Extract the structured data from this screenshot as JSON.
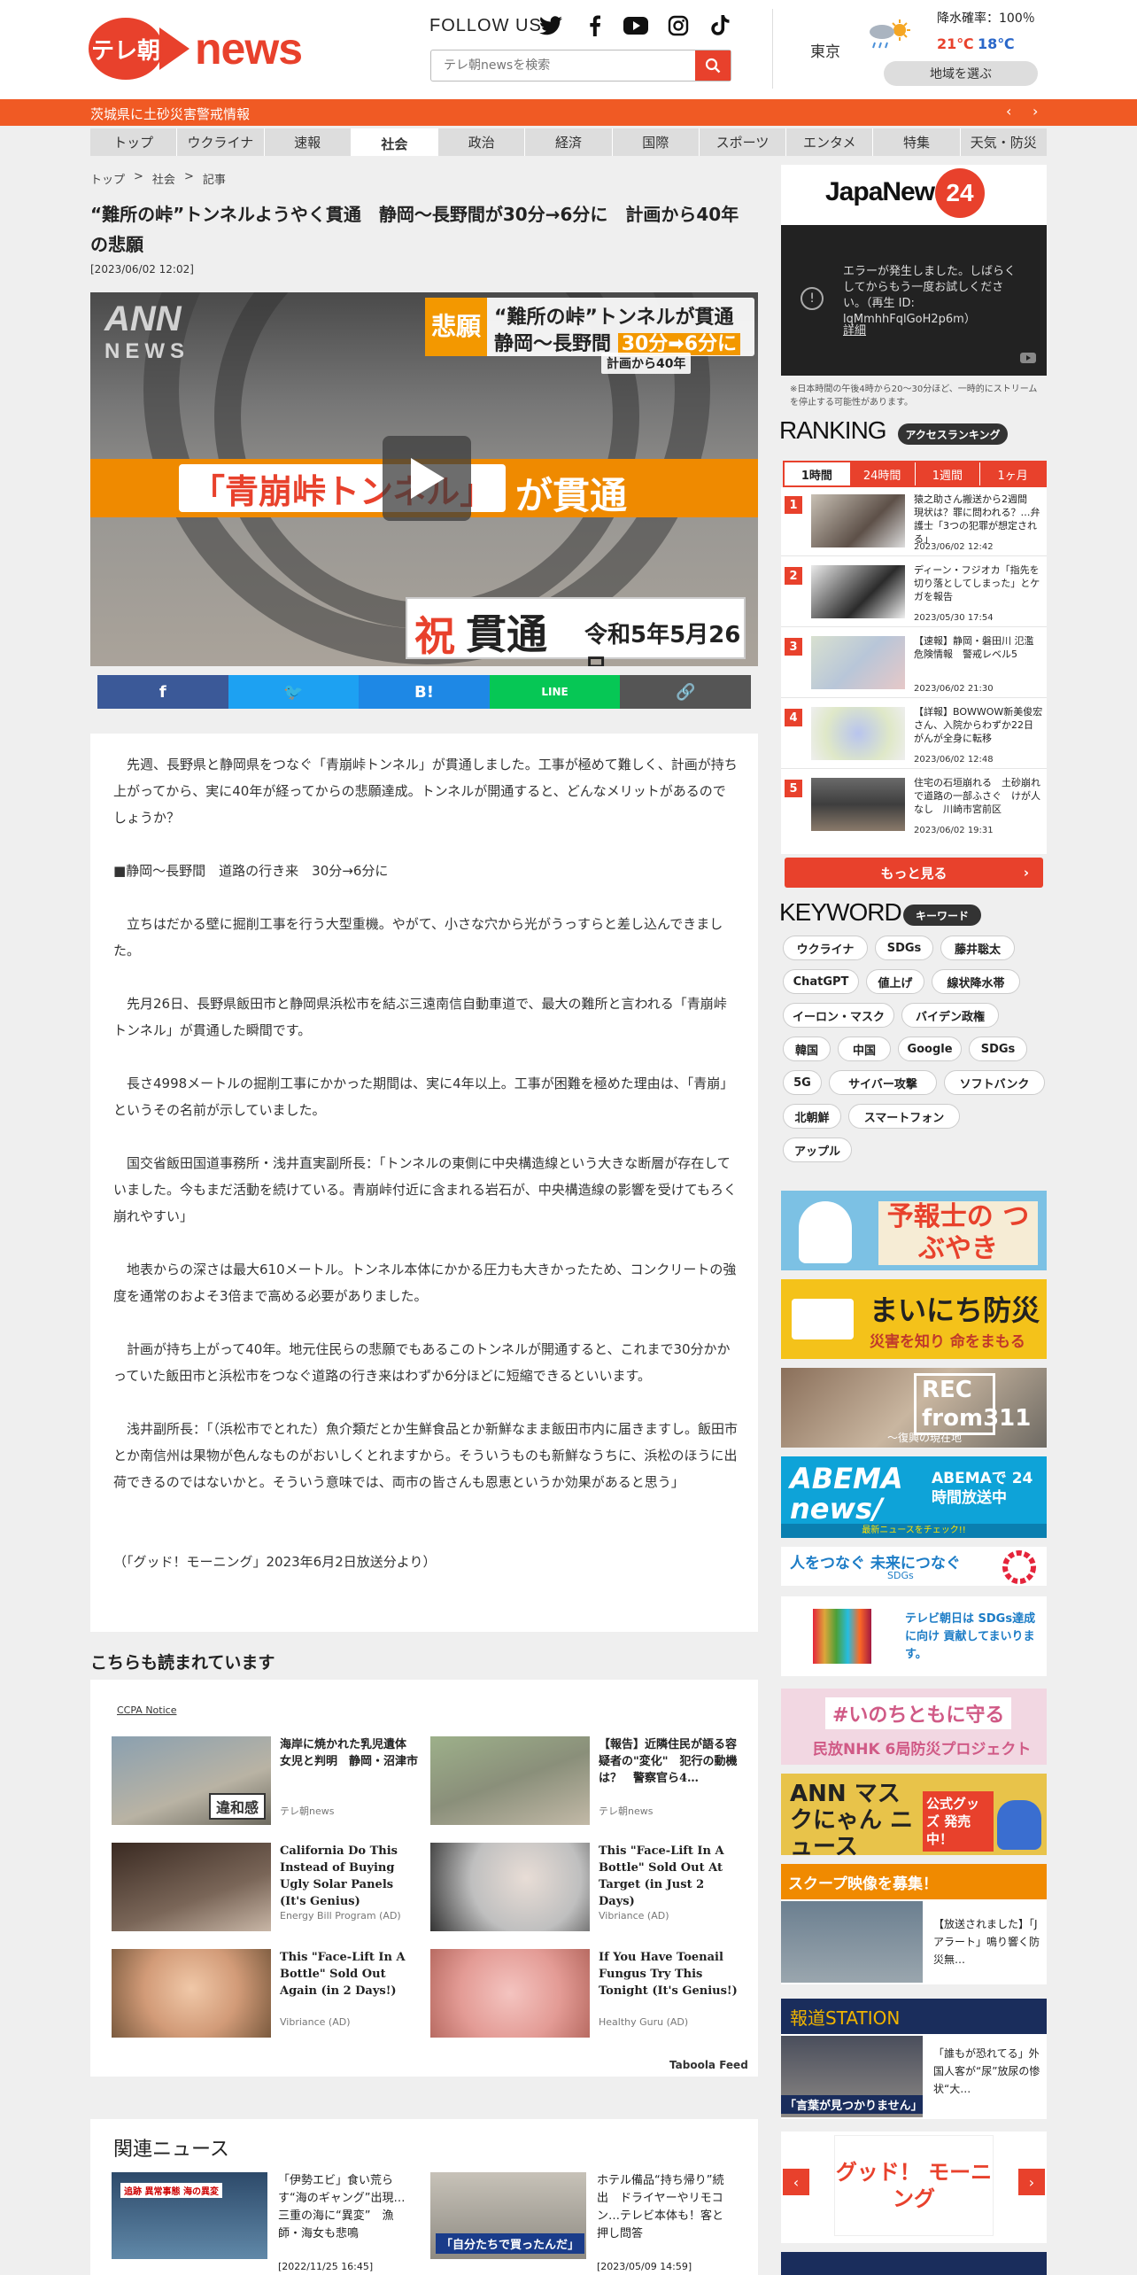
{
  "header": {
    "logo_mark": "テレ朝",
    "logo_text": "news",
    "follow": "FOLLOW US",
    "search_placeholder": "テレ朝newsを検索",
    "weather": {
      "city": "東京",
      "rain_label": "降水確率：100％",
      "max": "21℃",
      "min": "18℃",
      "region_button": "地域を選ぶ"
    }
  },
  "alert": {
    "text": "茨城県に土砂災害警戒情報",
    "prev": "‹",
    "next": "›"
  },
  "nav": [
    "トップ",
    "ウクライナ",
    "速報",
    "社会",
    "政治",
    "経済",
    "国際",
    "スポーツ",
    "エンタメ",
    "特集",
    "天気・防災"
  ],
  "breadcrumb": [
    "トップ",
    ">",
    "社会",
    ">",
    "記事"
  ],
  "article": {
    "title": "“難所の峠”トンネルようやく貫通　静岡〜長野間が30分→6分に　計画から40年の悲願",
    "date": "[2023/06/02 12:02]",
    "video": {
      "watermark1": "ANN",
      "watermark2": "NEWS",
      "tag": "悲願",
      "cap1": "“難所の峠”トンネルが貫通",
      "cap2a": "静岡〜長野間",
      "cap2b": "30分➡6分に",
      "cap_sub": "計画から40年",
      "band_box": "「青崩峠トンネル」",
      "band_rest": "が貫通",
      "sign1": "祝",
      "sign2": "貫通",
      "sign3": "令和5年5月26日"
    },
    "share": [
      "f",
      "🐦",
      "B!",
      "LINE",
      "🔗"
    ],
    "paragraphs": [
      "　先週、長野県と静岡県をつなぐ「青崩峠トンネル」が貫通しました。工事が極めて難しく、計画が持ち上がってから、実に40年が経ってからの悲願達成。トンネルが開通すると、どんなメリットがあるのでしょうか？",
      "■静岡〜長野間　道路の行き来　30分→6分に",
      "　立ちはだかる壁に掘削工事を行う大型重機。やがて、小さな穴から光がうっすらと差し込んできました。",
      "　先月26日、長野県飯田市と静岡県浜松市を結ぶ三遠南信自動車道で、最大の難所と言われる「青崩峠トンネル」が貫通した瞬間です。",
      "　長さ4998メートルの掘削工事にかかった期間は、実に4年以上。工事が困難を極めた理由は、「青崩」というその名前が示していました。",
      "　国交省飯田国道事務所・浅井直実副所長：「トンネルの東側に中央構造線という大きな断層が存在していました。今もまだ活動を続けている。青崩峠付近に含まれる岩石が、中央構造線の影響を受けてもろく崩れやすい」",
      "　地表からの深さは最大610メートル。トンネル本体にかかる圧力も大きかったため、コンクリートの強度を通常のおよそ3倍まで高める必要がありました。",
      "　計画が持ち上がって40年。地元住民らの悲願でもあるこのトンネルが開通すると、これまで30分かかっていた飯田市と浜松市をつなぐ道路の行き来はわずか6分ほどに短縮できるといいます。",
      "　浅井副所長：「（浜松市でとれた）魚介類だとか生鮮食品とか新鮮なまま飯田市内に届きますし。飯田市とか南信州は果物が色んなものがおいしくとれますから。そういうものも新鮮なうちに、浜松のほうに出荷できるのではないかと。そういう意味では、両市の皆さんも恩恵というか効果があると思う」",
      "（「グッド！モーニング」2023年6月2日放送分より）"
    ]
  },
  "also": {
    "heading": "こちらも読まれています",
    "ccpa": "CCPA Notice",
    "feed": "Taboola Feed",
    "items": [
      {
        "title": "海岸に焼かれた乳児遺体　女児と判明　静岡・沼津市",
        "source": "テレ朝news",
        "badge": "違和感"
      },
      {
        "title": "【報告】近隣住民が語る容疑者の\"変化\"　犯行の動機は？　警察官ら4…",
        "source": "テレ朝news"
      },
      {
        "title": "California Do This Instead of Buying Ugly Solar Panels (It's Genius)",
        "source": "Energy Bill Program (AD)"
      },
      {
        "title": "This \"Face-Lift In A Bottle\" Sold Out At Target (in Just 2 Days)",
        "source": "Vibriance (AD)"
      },
      {
        "title": "This \"Face-Lift In A Bottle\" Sold Out Again (in 2 Days!)",
        "source": "Vibriance (AD)"
      },
      {
        "title": "If You Have Toenail Fungus Try This Tonight (It's Genius!)",
        "source": "Healthy Guru (AD)"
      }
    ]
  },
  "related": {
    "heading": "関連ニュース",
    "items": [
      {
        "title": "「伊勢エビ」食い荒らす“海のギャング”出現…三重の海に“異変”　漁師・海女も悲鳴",
        "date": "[2022/11/25 16:45]",
        "badge": "追跡 異常事態 海の異変"
      },
      {
        "title": "ホテル備品“持ち帰り”続出　ドライヤーやリモコン…テレビ本体も！客と押し問答",
        "date": "[2023/05/09 14:59]",
        "badge": "「自分たちで買ったんだ」"
      }
    ]
  },
  "sidebar": {
    "japanews": {
      "text": "JapaNews",
      "num": "24"
    },
    "player_error": {
      "message": "エラーが発生しました。しばらくしてからもう一度お試しください。（再生 ID: lqMmhhFqlGoH2p6m）",
      "link": "詳細"
    },
    "note": "※日本時間の午後4時から20～30分ほど、一時的にストリームを停止する可能性があります。",
    "ranking": {
      "heading": "RANKING",
      "pill": "アクセスランキング",
      "tabs": [
        "1時間",
        "24時間",
        "1週間",
        "1ヶ月"
      ],
      "items": [
        {
          "n": "1",
          "title": "猿之助さん搬送から2週間　現状は？罪に問われる？…弁護士「3つの犯罪が想定される」",
          "date": "2023/06/02 12:42"
        },
        {
          "n": "2",
          "title": "ディーン・フジオカ「指先を切り落としてしまった」とケガを報告",
          "date": "2023/05/30 17:54"
        },
        {
          "n": "3",
          "title": "【速報】静岡・磐田川 氾濫危険情報　警戒レベル5",
          "date": "2023/06/02 21:30"
        },
        {
          "n": "4",
          "title": "【詳報】BOWWOW新美俊宏さん、入院からわずか22日 がんが全身に転移",
          "date": "2023/06/02 12:48"
        },
        {
          "n": "5",
          "title": "住宅の石垣崩れる　土砂崩れで道路の一部ふさぐ　けが人なし　川崎市宮前区",
          "date": "2023/06/02 19:31"
        }
      ],
      "more": "もっと見る"
    },
    "keyword": {
      "heading": "KEYWORD",
      "pill": "キーワード",
      "tags": [
        "ウクライナ",
        "SDGs",
        "藤井聡太",
        "ChatGPT",
        "値上げ",
        "線状降水帯",
        "イーロン・マスク",
        "バイデン政権",
        "韓国",
        "中国",
        "Google",
        "SDGs",
        "5G",
        "サイバー攻撃",
        "ソフトバンク",
        "北朝鮮",
        "スマートフォン",
        "アップル"
      ]
    },
    "banners": {
      "yohoshi": "予報士の つぶやき",
      "bosai1": "まいにち防災",
      "bosai2": "災害を知り 命をまもる",
      "rec": "REC from311",
      "rec2": "～復興の現在地",
      "abema1": "ABEMA news/",
      "abema2": "ABEMAで 24時間放送中",
      "abema3": "最新ニュースをチェック!!",
      "sdgs1": "人をつなぐ 未来につなぐ",
      "sdgs2": "SDGs",
      "sdgs3": "テレビ朝日は SDGs達成に向け 貢献してまいります。",
      "inochi1": "#いのちともに守る",
      "inochi2": "民放NHK 6局防災プロジェクト",
      "mask1": "ANN マスクにゃん ニュース",
      "mask2": "公式グッズ 発売中！",
      "scoop1": "スクープ映像を募集！",
      "scoop2": "【放送されました】「Jアラート」鳴り響く防災無…",
      "hodo1": "報道STATION",
      "hodo2": "「誰もが恐れてる」外国人客が“尿”放尿の惨状“大…",
      "hodo3": "「言葉が見つかりません」",
      "good": "グッド！ モーニング"
    }
  },
  "colors": {
    "brand_red": "#e8412c",
    "alert_orange": "#f05a24"
  }
}
